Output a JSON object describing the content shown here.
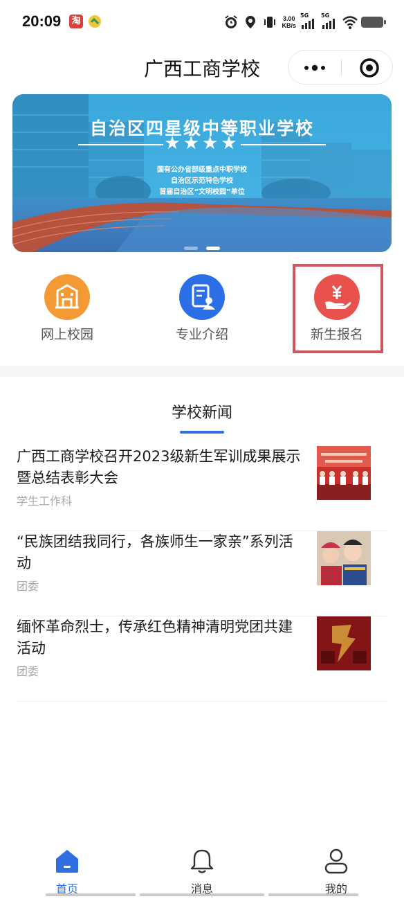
{
  "status_bar": {
    "time": "20:09",
    "app_badge": "淘",
    "net_speed_value": "3.00",
    "net_speed_unit": "KB/s",
    "signal_1": "5G",
    "signal_2": "5G",
    "icons": [
      "alarm-icon",
      "location-icon",
      "vibrate-icon",
      "signal-icon",
      "wifi-icon",
      "battery-icon"
    ]
  },
  "nav": {
    "title": "广西工商学校"
  },
  "banner": {
    "title": "自治区四星级中等职业学校",
    "stars": "★★★★",
    "lines": [
      "国有公办省部级重点中职学校",
      "自治区示范特色学校",
      "首届自治区“文明校园”单位"
    ],
    "active_dot": 1
  },
  "quick_menu": [
    {
      "label": "网上校园",
      "icon": "school-icon",
      "color": "#f39a34"
    },
    {
      "label": "专业介绍",
      "icon": "document-user-icon",
      "color": "#2b6fe6"
    },
    {
      "label": "新生报名",
      "icon": "yuan-hand-icon",
      "color": "#e9514d"
    }
  ],
  "news": {
    "heading": "学校新闻",
    "items": [
      {
        "title": "广西工商学校召开2023级新生军训成果展示暨总结表彰大会",
        "source": "学生工作科"
      },
      {
        "title": "“民族团结我同行，各族师生一家亲”系列活动",
        "source": "团委"
      },
      {
        "title": "缅怀革命烈士，传承红色精神清明党团共建活动",
        "source": "团委"
      }
    ]
  },
  "tab_bar": {
    "tabs": [
      {
        "label": "首页",
        "icon": "home-icon",
        "active": true
      },
      {
        "label": "消息",
        "icon": "bell-icon",
        "active": false
      },
      {
        "label": "我的",
        "icon": "person-icon",
        "active": false
      }
    ],
    "active_color": "#2f6fe0",
    "inactive_color": "#333333"
  }
}
